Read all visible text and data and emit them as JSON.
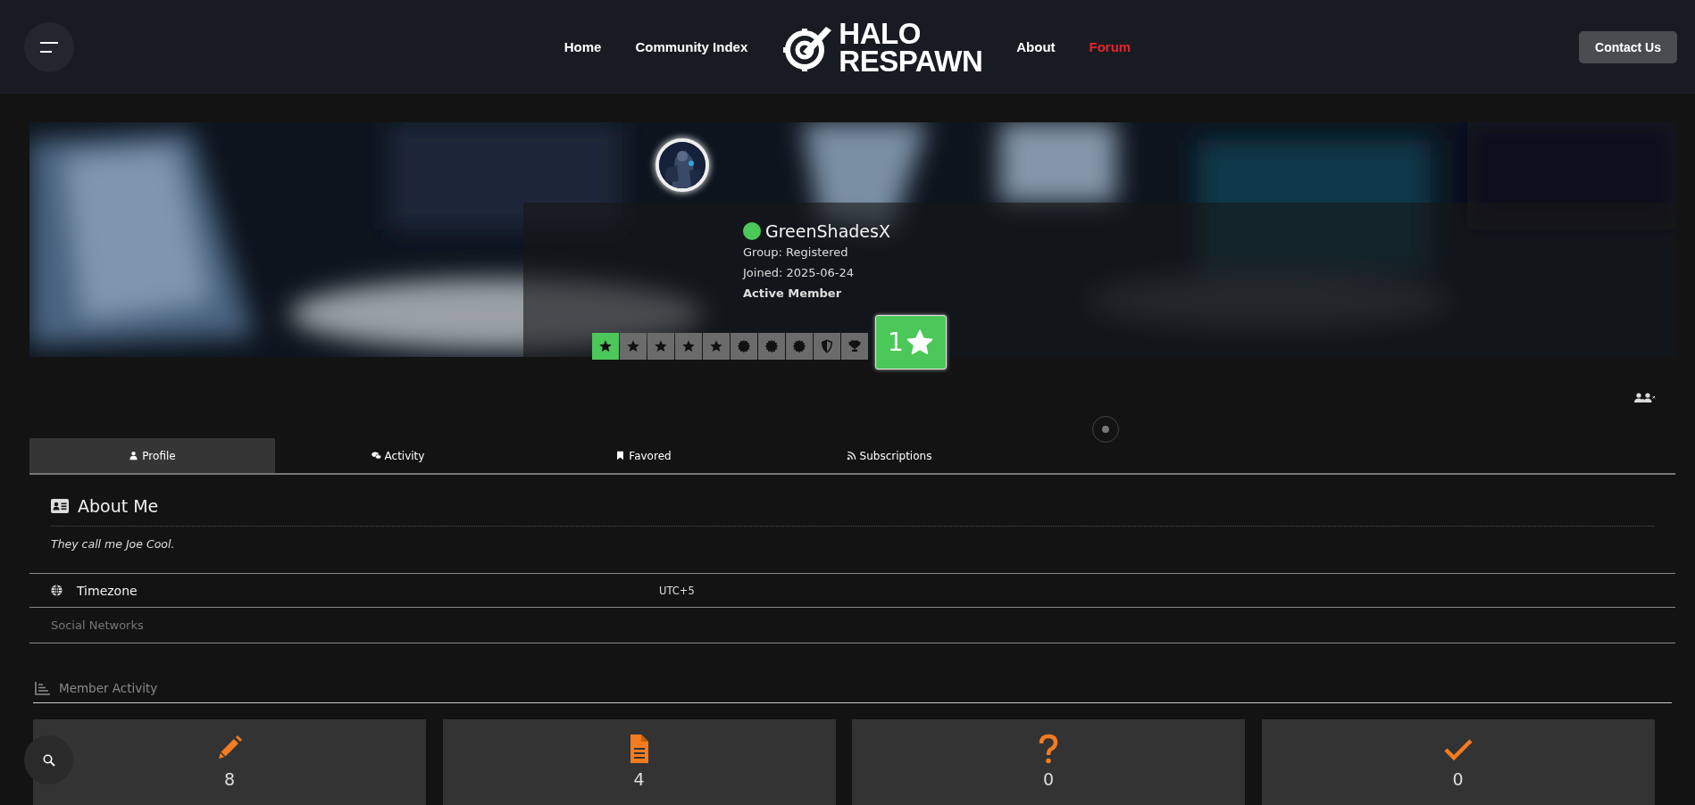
{
  "header": {
    "nav_left": [
      {
        "label": "Home",
        "selected": false
      },
      {
        "label": "Community Index",
        "selected": false
      }
    ],
    "logo_lines": [
      "HALO",
      "RESPAWN"
    ],
    "nav_right": [
      {
        "label": "About",
        "selected": false
      },
      {
        "label": "Forum",
        "selected": true
      }
    ],
    "contact_button": "Contact Us"
  },
  "profile": {
    "online": true,
    "username": "GreenShadesX",
    "group": "Group: Registered",
    "joined": "Joined: 2025-06-24",
    "title": "Active Member",
    "badges": [
      {
        "kind": "star",
        "earned": true
      },
      {
        "kind": "star",
        "earned": false
      },
      {
        "kind": "star",
        "earned": false
      },
      {
        "kind": "star",
        "earned": false
      },
      {
        "kind": "star",
        "earned": false
      },
      {
        "kind": "seal",
        "earned": false
      },
      {
        "kind": "seal",
        "earned": false
      },
      {
        "kind": "seal",
        "earned": false
      },
      {
        "kind": "shield",
        "earned": false
      },
      {
        "kind": "trophy",
        "earned": false
      }
    ],
    "rank": "1"
  },
  "tabs": [
    {
      "label": "Profile",
      "kind": "user",
      "selected": true
    },
    {
      "label": "Activity",
      "kind": "comments",
      "selected": false
    },
    {
      "label": "Favored",
      "kind": "bookmark",
      "selected": false
    },
    {
      "label": "Subscriptions",
      "kind": "rss",
      "selected": false
    }
  ],
  "about": {
    "heading": "About Me",
    "text": "They call me Joe Cool."
  },
  "fields": [
    {
      "label": "Timezone",
      "value": "UTC+5"
    }
  ],
  "social_label": "Social Networks",
  "member_activity": {
    "heading": "Member Activity",
    "stats": [
      {
        "kind": "pencil",
        "value": "8"
      },
      {
        "kind": "document",
        "value": "4"
      },
      {
        "kind": "question",
        "value": "0"
      },
      {
        "kind": "check",
        "value": "0"
      }
    ]
  }
}
